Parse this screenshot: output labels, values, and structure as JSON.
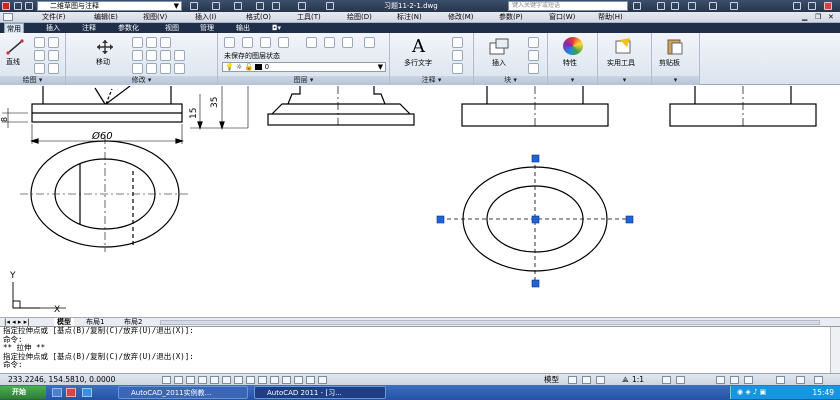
{
  "titlebar": {
    "workspace": "二维草图与注释",
    "title": "习题11-2-1.dwg",
    "search_placeholder": "键入关键字或短语"
  },
  "menu": [
    "文件(F)",
    "编辑(E)",
    "视图(V)",
    "插入(I)",
    "格式(O)",
    "工具(T)",
    "绘图(D)",
    "标注(N)",
    "修改(M)",
    "参数(P)",
    "窗口(W)",
    "帮助(H)"
  ],
  "ribbon_tabs": [
    "常用",
    "插入",
    "注释",
    "参数化",
    "视图",
    "管理",
    "输出"
  ],
  "ribbon": {
    "line_label": "直线",
    "move_label": "移动",
    "layer_state": "未保存的图层状态",
    "layer_current": "0",
    "mtext_label": "多行文字",
    "insert_label": "插入",
    "props_label": "特性",
    "utils_label": "实用工具",
    "clipboard_label": "剪贴板",
    "panels": {
      "draw": "绘图",
      "modify": "修改",
      "layer": "图层",
      "annotate": "注释",
      "block": "块"
    }
  },
  "drawing": {
    "dim_diameter": "Ø60",
    "dim_35": "35",
    "dim_15": "15",
    "dim_8": "8",
    "ucs_y": "Y",
    "ucs_x": "X"
  },
  "layout_tabs": [
    "模型",
    "布局1",
    "布局2"
  ],
  "command_lines": [
    "指定拉伸点或 [基点(B)/复制(C)/放弃(U)/退出(X)]:",
    "命令:",
    "** 拉伸 **",
    "指定拉伸点或 [基点(B)/复制(C)/放弃(U)/退出(X)]:",
    "命令:"
  ],
  "status": {
    "coords": "233.2246, 154.5810, 0.0000",
    "model": "模型",
    "scale": "1:1"
  },
  "taskbar": {
    "start": "开始",
    "task1": "AutoCAD_2011实例教...",
    "task2": "AutoCAD 2011 - [习...",
    "time": "15:49"
  },
  "colors": {
    "titlebar": "#27344b",
    "ribbon_tab_bar": "#1f2f4a",
    "grip": "#1e64d6",
    "taskbar": "#2452a6"
  }
}
